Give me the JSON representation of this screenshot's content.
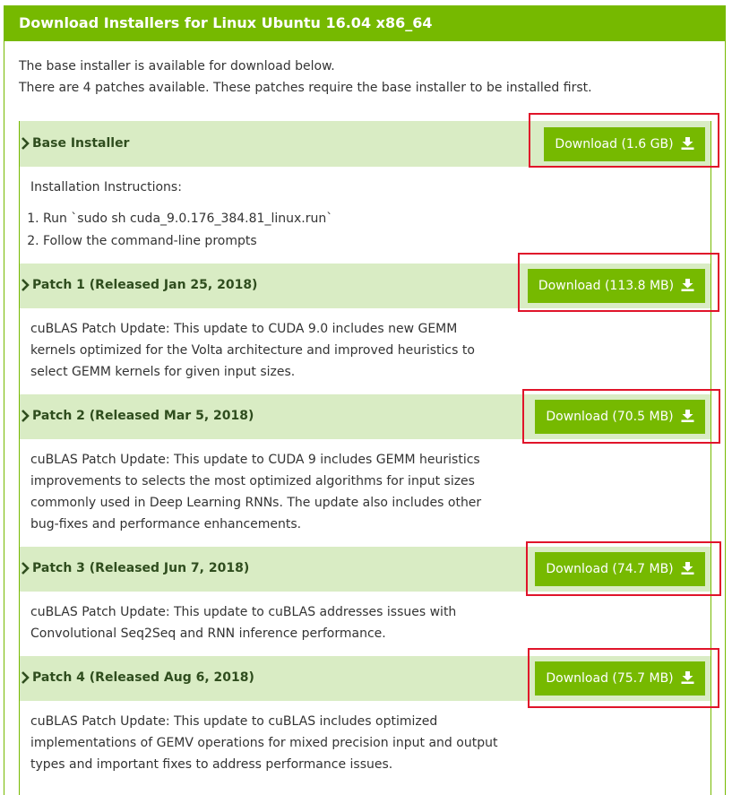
{
  "header": {
    "title": "Download Installers for Linux Ubuntu 16.04 x86_64"
  },
  "intro": {
    "line1": "The base installer is available for download below.",
    "line2": "There are 4 patches available. These patches require the base installer to be installed first."
  },
  "base": {
    "title": "Base Installer",
    "button": "Download (1.6 GB)",
    "instructions_heading": "Installation Instructions:",
    "steps": [
      "Run `sudo sh cuda_9.0.176_384.81_linux.run`",
      "Follow the command-line prompts"
    ]
  },
  "patches": [
    {
      "title": "Patch 1 (Released Jan 25, 2018)",
      "button": "Download (113.8 MB)",
      "desc": [
        "cuBLAS Patch Update: This update to CUDA 9.0 includes new GEMM",
        "kernels optimized for the Volta architecture and improved heuristics to",
        "select GEMM kernels for given input sizes."
      ]
    },
    {
      "title": "Patch 2 (Released Mar 5, 2018)",
      "button": "Download (70.5 MB)",
      "desc": [
        "cuBLAS Patch Update: This update to CUDA 9 includes GEMM heuristics",
        "improvements to selects the most optimized algorithms for input sizes",
        "commonly used in Deep Learning RNNs. The update also includes other",
        "bug-fixes and performance enhancements."
      ]
    },
    {
      "title": "Patch 3 (Released Jun 7, 2018)",
      "button": "Download (74.7 MB)",
      "desc": [
        "cuBLAS Patch Update: This update to cuBLAS addresses issues with",
        "Convolutional Seq2Seq and RNN inference performance."
      ]
    },
    {
      "title": "Patch 4 (Released Aug 6, 2018)",
      "button": "Download (75.7 MB)",
      "desc": [
        "cuBLAS Patch Update: This update to cuBLAS includes optimized",
        "implementations of GEMV operations for mixed precision input and output",
        "types and important fixes to address performance issues."
      ]
    }
  ],
  "colors": {
    "accent": "#76b900",
    "row_bg": "#d9ecc4",
    "highlight": "#e0142a"
  },
  "icons": {
    "expand": "chevron-right-icon",
    "download": "download-icon"
  }
}
